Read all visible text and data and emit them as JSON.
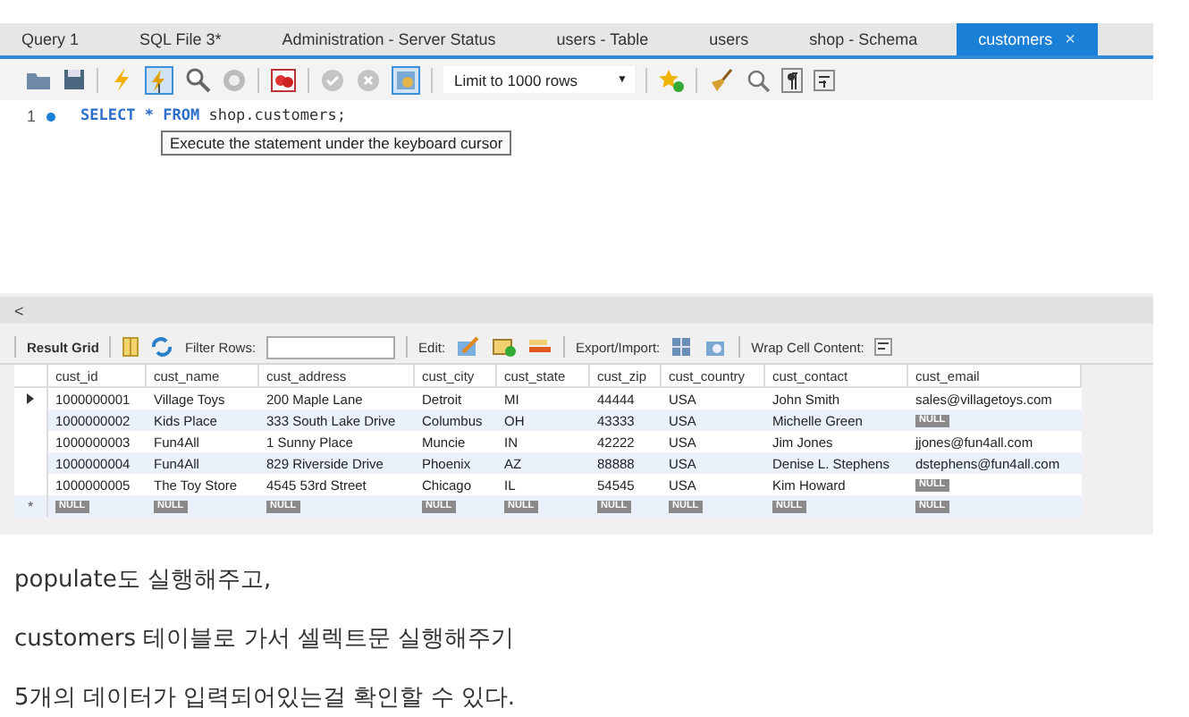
{
  "tabs": [
    {
      "label": "Query 1",
      "selected": false
    },
    {
      "label": "SQL File 3*",
      "selected": false
    },
    {
      "label": "Administration - Server Status",
      "selected": false
    },
    {
      "label": "users - Table",
      "selected": false
    },
    {
      "label": "users",
      "selected": false
    },
    {
      "label": "shop - Schema",
      "selected": false
    },
    {
      "label": "customers",
      "selected": true,
      "close": "×"
    }
  ],
  "toolbar": {
    "limit": "Limit to 1000 rows",
    "caret": "▼"
  },
  "editor": {
    "line_number": "1",
    "tokens": [
      {
        "text": "SELECT",
        "kind": "keyword"
      },
      {
        "text": "*",
        "kind": "operator"
      },
      {
        "text": "FROM",
        "kind": "keyword"
      },
      {
        "text": "shop.customers;",
        "kind": "identifier"
      }
    ],
    "tooltip": "Execute the statement under the keyboard cursor",
    "scroll_left": "<"
  },
  "result_toolbar": {
    "result_grid": "Result Grid",
    "filter_label": "Filter Rows:",
    "edit_label": "Edit:",
    "export_label": "Export/Import:",
    "wrap_label": "Wrap Cell Content:"
  },
  "table": {
    "columns": [
      "cust_id",
      "cust_name",
      "cust_address",
      "cust_city",
      "cust_state",
      "cust_zip",
      "cust_country",
      "cust_contact",
      "cust_email"
    ],
    "rows": [
      {
        "current": true,
        "cells": [
          "1000000001",
          "Village Toys",
          "200 Maple Lane",
          "Detroit",
          "MI",
          "44444",
          "USA",
          "John Smith",
          "sales@villagetoys.com"
        ]
      },
      {
        "current": false,
        "cells": [
          "1000000002",
          "Kids Place",
          "333 South Lake Drive",
          "Columbus",
          "OH",
          "43333",
          "USA",
          "Michelle Green",
          {
            "null_badge": "NULL"
          }
        ]
      },
      {
        "current": false,
        "cells": [
          "1000000003",
          "Fun4All",
          "1 Sunny Place",
          "Muncie",
          "IN",
          "42222",
          "USA",
          "Jim Jones",
          "jjones@fun4all.com"
        ]
      },
      {
        "current": false,
        "cells": [
          "1000000004",
          "Fun4All",
          "829 Riverside Drive",
          "Phoenix",
          "AZ",
          "88888",
          "USA",
          "Denise L. Stephens",
          "dstephens@fun4all.com"
        ]
      },
      {
        "current": false,
        "cells": [
          "1000000005",
          "The Toy Store",
          "4545 53rd Street",
          "Chicago",
          "IL",
          "54545",
          "USA",
          "Kim Howard",
          {
            "null_badge": "NULL"
          }
        ]
      }
    ],
    "new_row": {
      "marker": "*",
      "cells": [
        {
          "null_badge": "NULL"
        },
        {
          "null_badge": "NULL"
        },
        {
          "null_badge": "NULL"
        },
        {
          "null_badge": "NULL"
        },
        {
          "null_badge": "NULL"
        },
        {
          "null_badge": "NULL"
        },
        {
          "null_badge": "NULL"
        },
        {
          "null_badge": "NULL"
        },
        {
          "null_badge": "NULL"
        }
      ]
    }
  },
  "notes": [
    "populate도 실행해주고,",
    "customers 테이블로 가서 셀렉트문 실행해주기",
    "5개의 데이터가 입력되어있는걸 확인할 수 있다."
  ]
}
